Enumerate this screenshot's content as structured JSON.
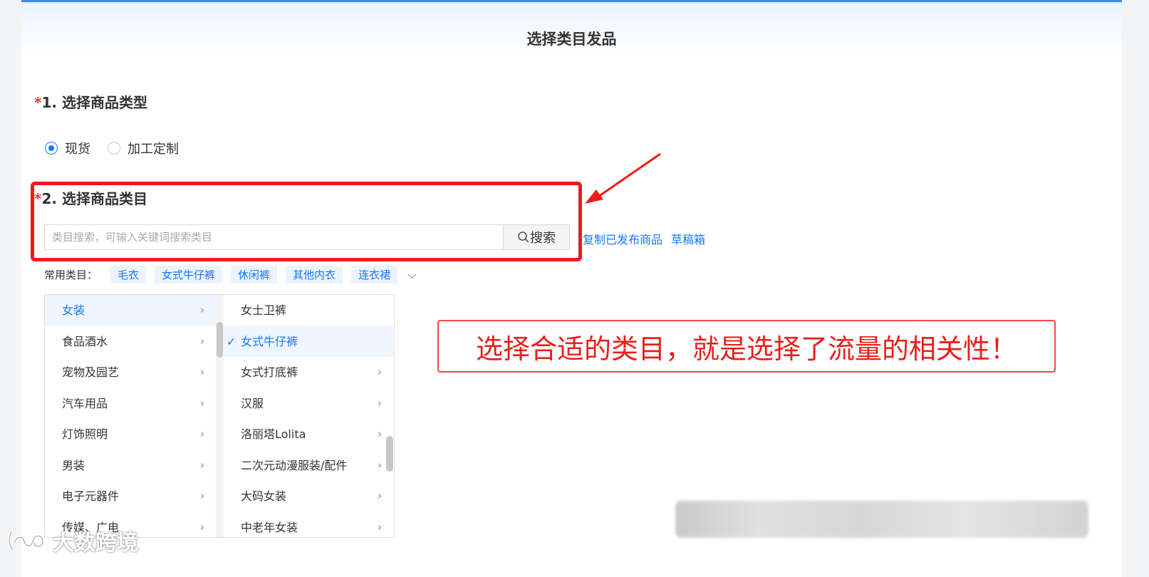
{
  "page": {
    "title": "选择类目发品"
  },
  "section1": {
    "star": "*",
    "title": "1. 选择商品类型",
    "options": [
      {
        "label": "现货",
        "checked": true
      },
      {
        "label": "加工定制",
        "checked": false
      }
    ]
  },
  "section2": {
    "star": "*",
    "title": "2. 选择商品类目",
    "search_placeholder": "类目搜索，可输入关键词搜索类目",
    "search_button": "搜索",
    "copy_link": "复制已发布商品",
    "draft_link": "草稿箱"
  },
  "common": {
    "label": "常用类目：",
    "tags": [
      "毛衣",
      "女式牛仔裤",
      "休闲裤",
      "其他内衣",
      "连衣裙"
    ]
  },
  "column1": [
    {
      "label": "女装",
      "active": true
    },
    {
      "label": "食品酒水"
    },
    {
      "label": "宠物及园艺"
    },
    {
      "label": "汽车用品"
    },
    {
      "label": "灯饰照明"
    },
    {
      "label": "男装"
    },
    {
      "label": "电子元器件"
    },
    {
      "label": "传媒、广电"
    }
  ],
  "column2": [
    {
      "label": "女士卫裤",
      "arrow": false
    },
    {
      "label": "女式牛仔裤",
      "active": true,
      "checked": true,
      "arrow": false
    },
    {
      "label": "女式打底裤",
      "arrow": true
    },
    {
      "label": "汉服",
      "arrow": true
    },
    {
      "label": "洛丽塔Lolita",
      "arrow": true
    },
    {
      "label": "二次元动漫服装/配件",
      "arrow": true
    },
    {
      "label": "大码女装",
      "arrow": true
    },
    {
      "label": "中老年女装",
      "arrow": true
    }
  ],
  "callout": "选择合适的类目，就是选择了流量的相关性！",
  "watermark": "大数跨境",
  "colors": {
    "accent": "#1677ff",
    "highlight_red": "#f0191a"
  }
}
